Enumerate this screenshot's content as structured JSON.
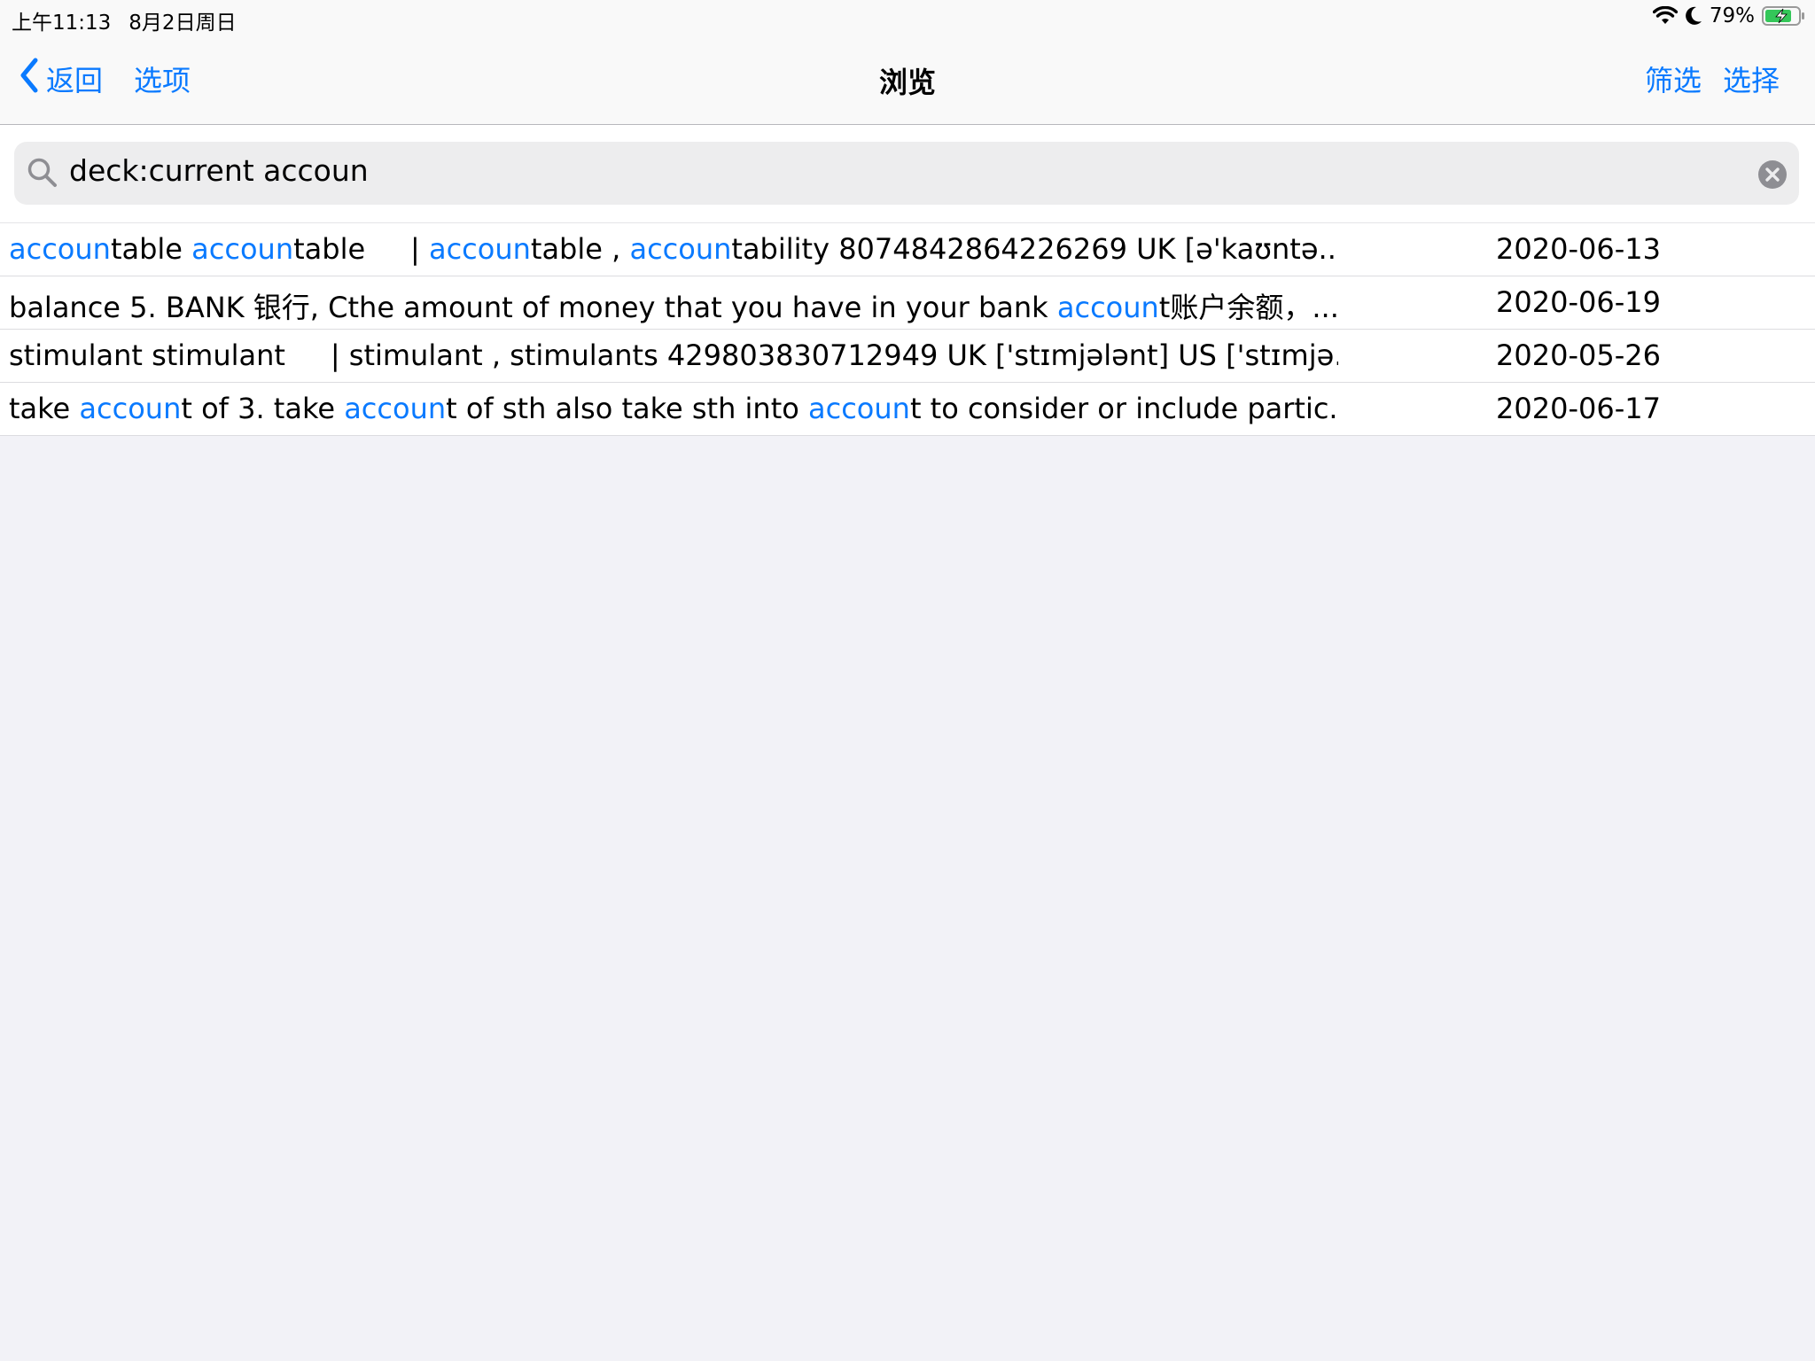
{
  "status_bar": {
    "time": "上午11:13",
    "date": "8月2日周日",
    "battery": "79%",
    "icons": [
      "wifi-icon",
      "moon-icon",
      "battery-charging-icon"
    ]
  },
  "nav": {
    "back_label": "返回",
    "options_label": "选项",
    "title": "浏览",
    "filter_label": "筛选",
    "select_label": "选择"
  },
  "search": {
    "value": "deck:current accoun"
  },
  "colors": {
    "accent": "#0a7aff",
    "background": "#f2f2f7"
  },
  "rows": [
    {
      "segments": [
        {
          "t": "accoun",
          "hl": true
        },
        {
          "t": "table ",
          "hl": false
        },
        {
          "t": "accoun",
          "hl": true
        },
        {
          "t": "table     | ",
          "hl": false
        },
        {
          "t": "accoun",
          "hl": true
        },
        {
          "t": "table , ",
          "hl": false
        },
        {
          "t": "accoun",
          "hl": true
        },
        {
          "t": "tability 8074842864226269 UK [ə'kaʊntə...",
          "hl": false
        }
      ],
      "date": "2020-06-13"
    },
    {
      "segments": [
        {
          "t": "balance 5. BANK 银行, Cthe amount of money that you have in your bank ",
          "hl": false
        },
        {
          "t": "accoun",
          "hl": true
        },
        {
          "t": "t账户余额，...",
          "hl": false
        }
      ],
      "date": "2020-06-19"
    },
    {
      "segments": [
        {
          "t": "stimulant stimulant     | stimulant , stimulants 429803830712949 UK ['stɪmjələnt] US ['stɪmjə...",
          "hl": false
        }
      ],
      "date": "2020-05-26"
    },
    {
      "segments": [
        {
          "t": "take ",
          "hl": false
        },
        {
          "t": "accoun",
          "hl": true
        },
        {
          "t": "t of 3. take ",
          "hl": false
        },
        {
          "t": "accoun",
          "hl": true
        },
        {
          "t": "t of sth also take sth into ",
          "hl": false
        },
        {
          "t": "accoun",
          "hl": true
        },
        {
          "t": "t to consider or include partic...",
          "hl": false
        }
      ],
      "date": "2020-06-17"
    }
  ]
}
